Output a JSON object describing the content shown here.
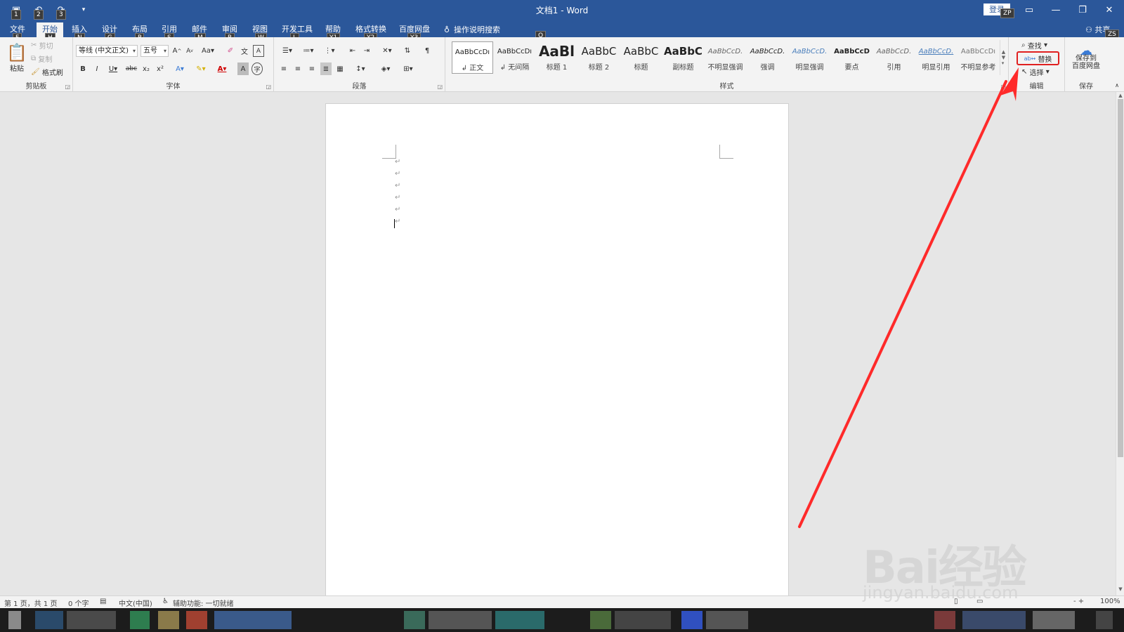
{
  "window": {
    "title": "文档1  -  Word",
    "login": "登录",
    "user_initials": "ZP",
    "share": "共享",
    "share_keytip": "ZS"
  },
  "qat": {
    "keytips": [
      "1",
      "2",
      "3"
    ]
  },
  "tabs": [
    {
      "label": "文件",
      "keytip": "F"
    },
    {
      "label": "开始",
      "keytip": "H",
      "active": true
    },
    {
      "label": "插入",
      "keytip": "N"
    },
    {
      "label": "设计",
      "keytip": "G"
    },
    {
      "label": "布局",
      "keytip": "P"
    },
    {
      "label": "引用",
      "keytip": "S"
    },
    {
      "label": "邮件",
      "keytip": "M"
    },
    {
      "label": "审阅",
      "keytip": "R"
    },
    {
      "label": "视图",
      "keytip": "W"
    },
    {
      "label": "开发工具",
      "keytip": "L"
    },
    {
      "label": "帮助",
      "keytip": "Y1"
    },
    {
      "label": "格式转换",
      "keytip": "Y2"
    },
    {
      "label": "百度网盘",
      "keytip": "Y3"
    }
  ],
  "tellme": {
    "label": "操作说明搜索",
    "keytip": "Q"
  },
  "clipboard": {
    "label": "剪贴板",
    "paste": "粘贴",
    "cut": "剪切",
    "copy": "复制",
    "format_painter": "格式刷"
  },
  "font": {
    "label": "字体",
    "name": "等线 (中文正文)",
    "size": "五号"
  },
  "paragraph": {
    "label": "段落"
  },
  "styles": {
    "label": "样式",
    "items": [
      {
        "sample": "AaBbCcDı",
        "name": "正文",
        "selected": true
      },
      {
        "sample": "AaBbCcDı",
        "name": "无间隔"
      },
      {
        "sample": "AaBl",
        "name": "标题 1"
      },
      {
        "sample": "AaBbC",
        "name": "标题 2"
      },
      {
        "sample": "AaBbC",
        "name": "标题"
      },
      {
        "sample": "AaBbC",
        "name": "副标题"
      },
      {
        "sample": "AaBbCcD.",
        "name": "不明显强调"
      },
      {
        "sample": "AaBbCcD.",
        "name": "强调"
      },
      {
        "sample": "AaBbCcD.",
        "name": "明显强调"
      },
      {
        "sample": "AaBbCcD",
        "name": "要点"
      },
      {
        "sample": "AaBbCcD.",
        "name": "引用"
      },
      {
        "sample": "AaBbCcD.",
        "name": "明显引用"
      },
      {
        "sample": "AaBbCcDı",
        "name": "不明显参考"
      }
    ]
  },
  "editing": {
    "label": "编辑",
    "find": "查找",
    "replace": "替换",
    "select": "选择"
  },
  "save": {
    "label": "保存",
    "button": "保存到百度网盘",
    "line1": "保存到",
    "line2": "百度网盘"
  },
  "document": {
    "paragraph_marks": [
      "↵",
      "↵",
      "↵",
      "↵",
      "↵",
      "↵"
    ]
  },
  "statusbar": {
    "pages": "第 1 页，共 1 页",
    "words": "0 个字",
    "language": "中文(中国)",
    "accessibility": "辅助功能: 一切就绪",
    "zoom": "100%"
  },
  "annotation": {
    "color": "#ff2a2a"
  },
  "watermark": {
    "brand": "Bai经验",
    "url": "jingyan.baidu.com"
  },
  "colors": {
    "brand": "#2b579a",
    "ribbon_bg": "#f3f3f3",
    "doc_bg": "#e6e6e6"
  }
}
